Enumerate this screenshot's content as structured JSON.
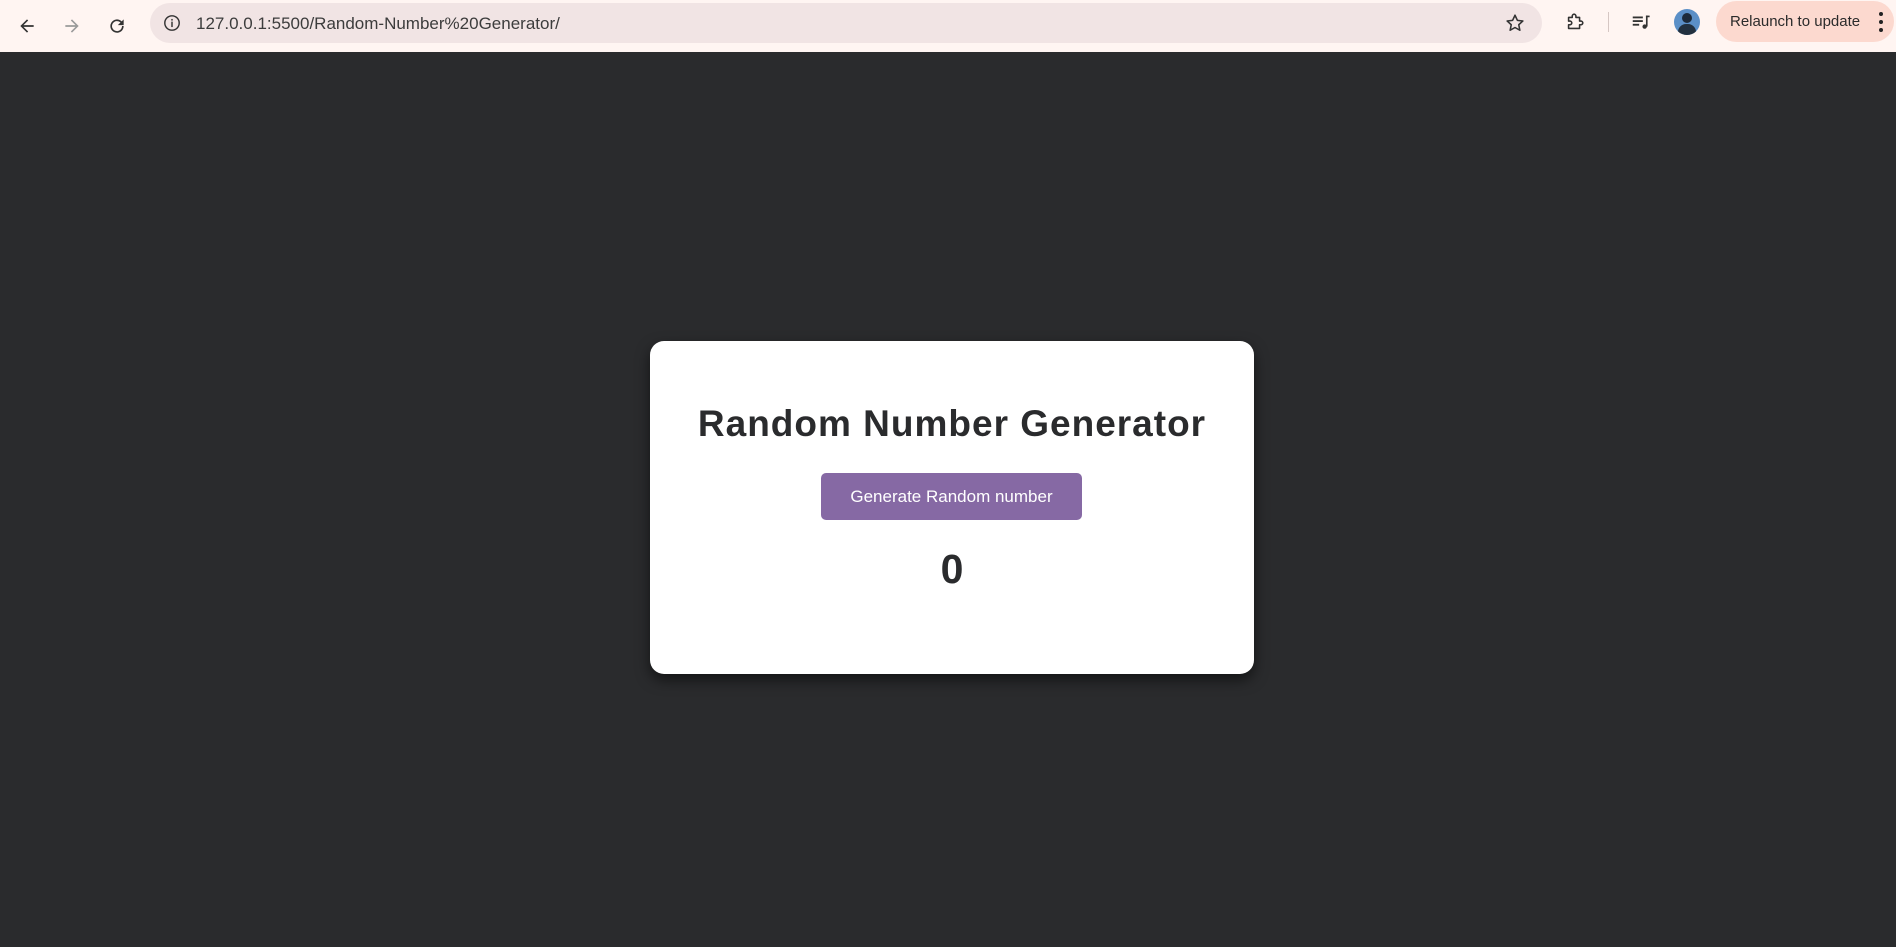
{
  "browser": {
    "url": "127.0.0.1:5500/Random-Number%20Generator/",
    "relaunch_label": "Relaunch to update",
    "icons": [
      "back-arrow-icon",
      "forward-arrow-icon",
      "reload-icon",
      "info-icon",
      "star-icon",
      "extensions-icon",
      "media-icon",
      "avatar",
      "kebab-menu-icon"
    ]
  },
  "app": {
    "title": "Random Number Generator",
    "button_label": "Generate Random number",
    "result": "0"
  },
  "colors": {
    "page_background": "#2a2b2d",
    "card_background": "#ffffff",
    "button_background": "#8669a4",
    "toolbar_background": "#fff5f2",
    "relaunch_background": "#fcd9cf"
  }
}
